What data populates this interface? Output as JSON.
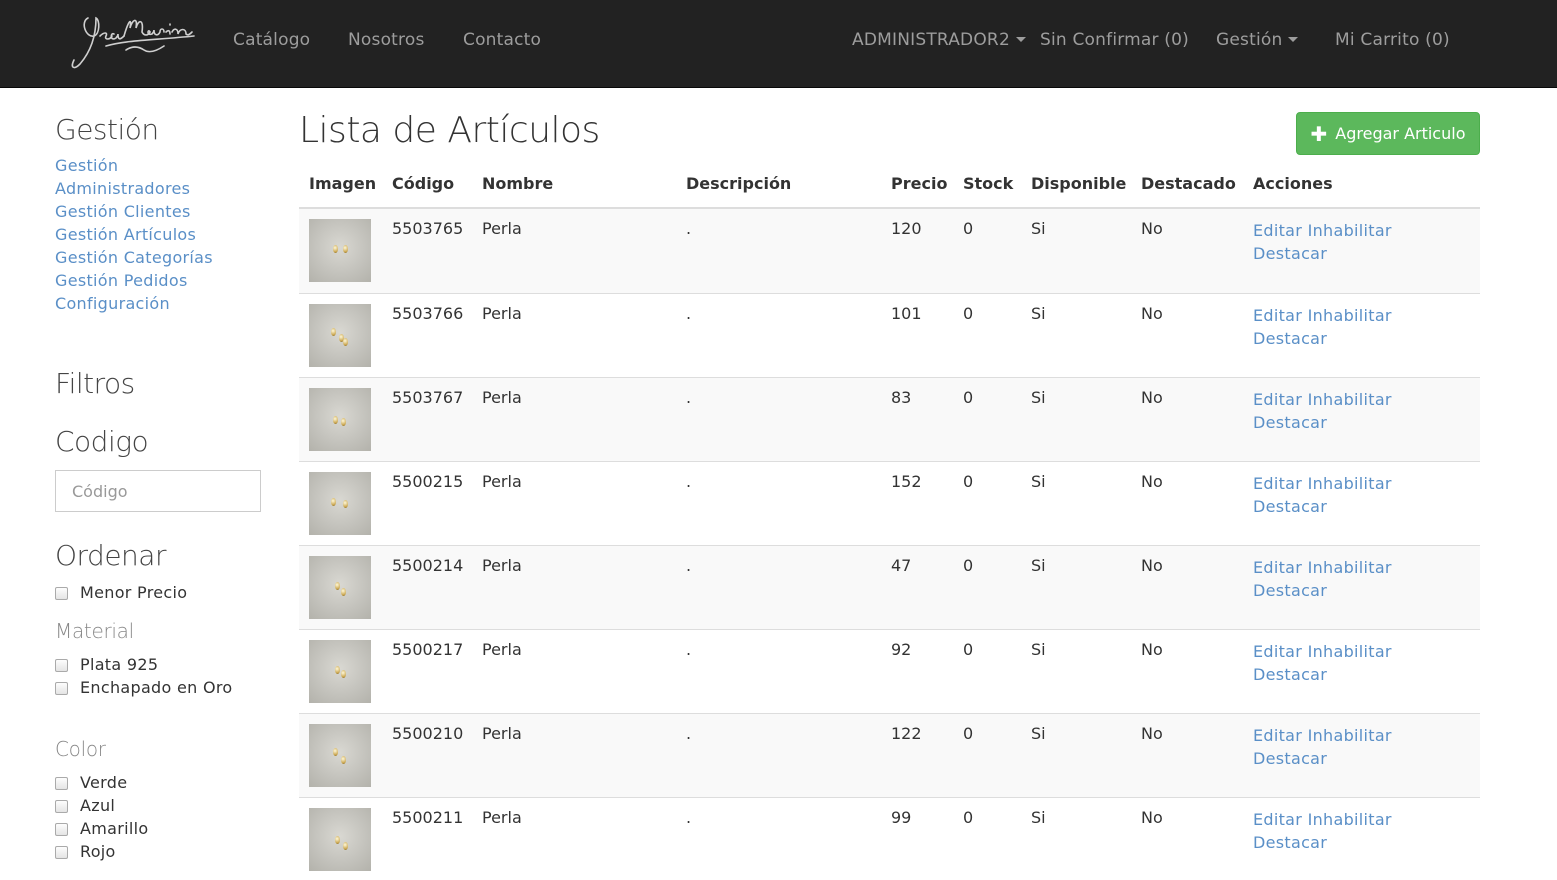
{
  "brand": {
    "logo_text": "YsaMarina"
  },
  "nav": {
    "left": [
      "Catálogo",
      "Nosotros",
      "Contacto"
    ],
    "user": "ADMINISTRADOR2",
    "unconfirmed": "Sin Confirmar (0)",
    "management": "Gestión",
    "cart": "Mi Carrito (0)"
  },
  "sidebar": {
    "management_title": "Gestión",
    "links": [
      "Gestión",
      "Administradores",
      "Gestión Clientes",
      "Gestión Artículos",
      "Gestión Categorías",
      "Gestión Pedidos",
      "Configuración"
    ],
    "filters_title": "Filtros",
    "code_title": "Codigo",
    "code_placeholder": "Código",
    "order_title": "Ordenar",
    "order_options": [
      "Menor Precio"
    ],
    "material_title": "Material",
    "material_options": [
      "Plata 925",
      "Enchapado en Oro"
    ],
    "color_title": "Color",
    "color_options": [
      "Verde",
      "Azul",
      "Amarillo",
      "Rojo"
    ]
  },
  "main": {
    "title": "Lista de Artículos",
    "add_button": "Agregar Articulo",
    "columns": [
      "Imagen",
      "Código",
      "Nombre",
      "Descripción",
      "Precio",
      "Stock",
      "Disponible",
      "Destacado",
      "Acciones"
    ],
    "rows": [
      {
        "code": "5503765",
        "name": "Perla",
        "description": ".",
        "price": "120",
        "stock": "0",
        "available": "Si",
        "featured": "No"
      },
      {
        "code": "5503766",
        "name": "Perla",
        "description": ".",
        "price": "101",
        "stock": "0",
        "available": "Si",
        "featured": "No"
      },
      {
        "code": "5503767",
        "name": "Perla",
        "description": ".",
        "price": "83",
        "stock": "0",
        "available": "Si",
        "featured": "No"
      },
      {
        "code": "5500215",
        "name": "Perla",
        "description": ".",
        "price": "152",
        "stock": "0",
        "available": "Si",
        "featured": "No"
      },
      {
        "code": "5500214",
        "name": "Perla",
        "description": ".",
        "price": "47",
        "stock": "0",
        "available": "Si",
        "featured": "No"
      },
      {
        "code": "5500217",
        "name": "Perla",
        "description": ".",
        "price": "92",
        "stock": "0",
        "available": "Si",
        "featured": "No"
      },
      {
        "code": "5500210",
        "name": "Perla",
        "description": ".",
        "price": "122",
        "stock": "0",
        "available": "Si",
        "featured": "No"
      },
      {
        "code": "5500211",
        "name": "Perla",
        "description": ".",
        "price": "99",
        "stock": "0",
        "available": "Si",
        "featured": "No"
      }
    ],
    "actions": {
      "edit": "Editar",
      "disable": "Inhabilitar",
      "feature": "Destacar"
    }
  },
  "colors": {
    "navbar": "#222222",
    "link": "#5a8fc7",
    "success": "#5cb85c",
    "stripe": "#f9f9f9"
  }
}
